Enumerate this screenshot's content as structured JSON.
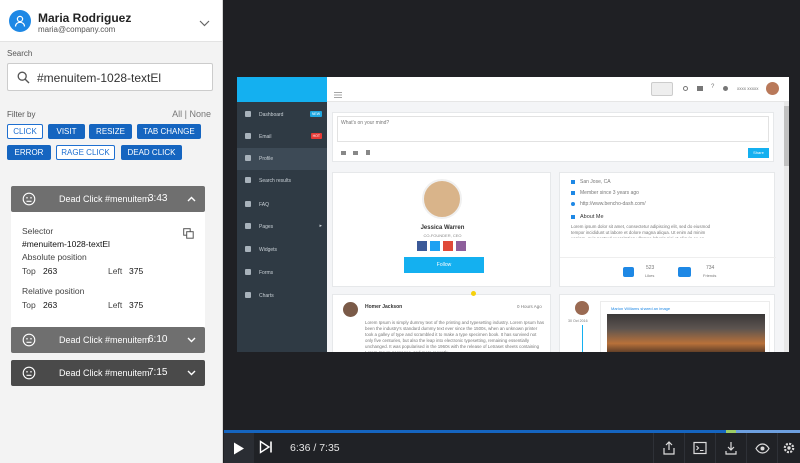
{
  "user": {
    "name": "Maria Rodriguez",
    "email": "maria@company.com"
  },
  "search": {
    "label": "Search",
    "value": "#menuitem-1028-textEl"
  },
  "filter": {
    "label": "Filter by",
    "all_none": "All | None",
    "buttons": [
      {
        "label": "CLICK",
        "active": false
      },
      {
        "label": "VISIT",
        "active": true
      },
      {
        "label": "RESIZE",
        "active": true
      },
      {
        "label": "TAB CHANGE",
        "active": true
      },
      {
        "label": "ERROR",
        "active": true
      },
      {
        "label": "RAGE CLICK",
        "active": false
      },
      {
        "label": "DEAD CLICK",
        "active": true
      }
    ]
  },
  "events": [
    {
      "title": "Dead Click #menuitem-1028-textEl",
      "time": "3:43",
      "expanded": true,
      "selector_label": "Selector",
      "selector_value": "#menuitem-1028-textEl",
      "absolute_label": "Absolute position",
      "absolute": {
        "top_label": "Top",
        "top": "263",
        "left_label": "Left",
        "left": "375"
      },
      "relative_label": "Relative position",
      "relative": {
        "top_label": "Top",
        "top": "263",
        "left_label": "Left",
        "left": "375"
      }
    },
    {
      "title": "Dead Click #menuitem-1028-textEl",
      "time": "6:10",
      "expanded": false
    },
    {
      "title": "Dead Click #menuitem-1028-textEl",
      "time": "7:15",
      "expanded": false
    }
  ],
  "recording": {
    "sidebar": [
      {
        "label": "Dashboard",
        "badge": "NEW",
        "badge_color": "#1ea7e1"
      },
      {
        "label": "Email",
        "badge": "HOT",
        "badge_color": "#e53935"
      },
      {
        "label": "Profile",
        "badge": ""
      },
      {
        "label": "Search results",
        "badge": ""
      },
      {
        "label": "FAQ",
        "badge": ""
      },
      {
        "label": "Pages",
        "badge": ""
      },
      {
        "label": "Widgets",
        "badge": ""
      },
      {
        "label": "Forms",
        "badge": ""
      },
      {
        "label": "Charts",
        "badge": ""
      }
    ],
    "topbar_user": "xxxx xxxxx",
    "post_placeholder": "What's on your mind?",
    "share_label": "Share",
    "profile_name": "Jessica Warren",
    "profile_role": "CO-FOUNDER, CEO",
    "follow_label": "Follow",
    "info": [
      "San Jose, CA",
      "Member since 3 years ago",
      "http://www.bencho-dash.com/"
    ],
    "about_title": "About Me",
    "about_text": "Lorem ipsum dolor sit amet, consectetur adipiscing elit, sed do eiusmod tempor incididunt ut labore et dolore magna aliqua. Ut enim ad minim veniam, quis nostrud exercitation ullamco laboris nisi ut aliquip ex ea commodo consequat. Duis aute irure dolor in reprehenderit in voluptate velit esse cillum dolore eu fugiat nulla pariatur.",
    "likes_count": "523",
    "likes_label": "Likes",
    "friends_count": "734",
    "friends_label": "Friends",
    "post_author": "Homer Jackson",
    "post_time": "0 Hours Ago",
    "post_text": "Lorem Ipsum is simply dummy text of the printing and typesetting industry. Lorem Ipsum has been the industry's standard dummy text ever since the 1500s, when an unknown printer took a galley of type and scrambled it to make a type specimen book. It has survived not only five centuries, but also the leap into electronic typesetting, remaining essentially unchanged. It was popularised in the 1960s with the release of Letraset sheets containing Lorem Ipsum passages, and more recently",
    "timeline_date": "30 Oct 2016",
    "timeline_text": "Marion Williams shared an image"
  },
  "player": {
    "time": "6:36 / 7:35"
  },
  "colors": {
    "accent": "#1565c0",
    "cyan": "#14b0f0",
    "sidebar_dark": "#2f3a44",
    "event_head": "#6f6f6f"
  }
}
